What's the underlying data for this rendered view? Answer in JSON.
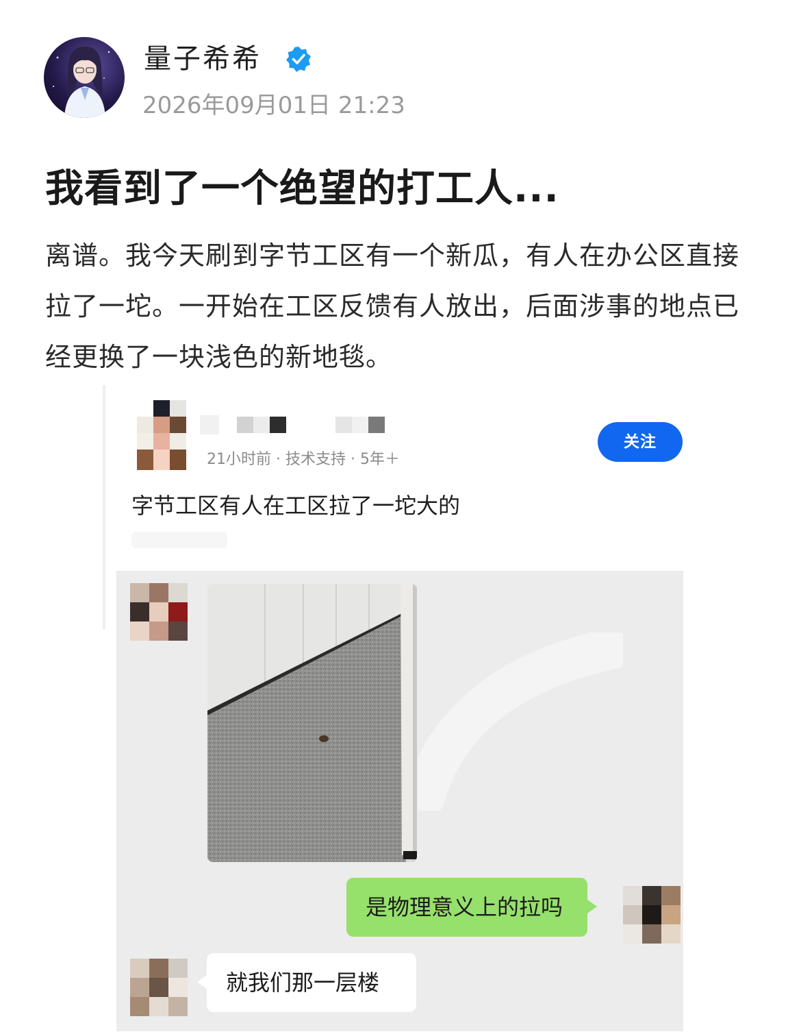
{
  "author": {
    "name": "量子希希",
    "timestamp": "2026年09月01日  21:23",
    "verified_icon": "verified-badge-icon",
    "accent_color": "#1d9bf0"
  },
  "post": {
    "title": "我看到了一个绝望的打工人...",
    "body": "离谱。我今天刷到字节工区有一个新瓜，有人在办公区直接拉了一坨。一开始在工区反馈有人放出，后面涉事的地点已经更换了一块浅色的新地毯。"
  },
  "embedded": {
    "meta": "21小时前 · 技术支持 · 5年＋",
    "follow_label": "关注",
    "follow_color": "#1167f0",
    "text": "字节工区有人在工区拉了一坨大的",
    "chat": {
      "messages": [
        {
          "side": "right",
          "text": "是物理意义上的拉吗",
          "bubble_color": "#96e06c"
        },
        {
          "side": "left",
          "text": "就我们那一层楼",
          "bubble_color": "#ffffff"
        }
      ]
    }
  }
}
